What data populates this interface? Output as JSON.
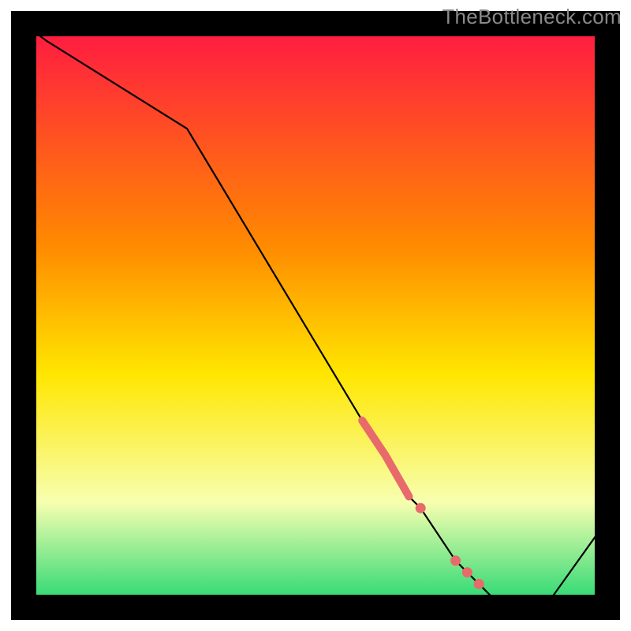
{
  "watermark": "TheBottleneck.com",
  "chart_data": {
    "type": "line",
    "title": "",
    "xlabel": "",
    "ylabel": "",
    "xlim": [
      0,
      100
    ],
    "ylim": [
      0,
      100
    ],
    "x": [
      0,
      4,
      28,
      58,
      62,
      66,
      68,
      72,
      74,
      76,
      78,
      80,
      85,
      90,
      100
    ],
    "values": [
      100,
      97,
      82,
      32,
      26,
      19,
      17,
      11,
      8,
      6,
      4,
      2,
      1,
      1,
      15
    ],
    "highlight_segment": {
      "x_start": 58,
      "x_end": 66,
      "width": 10
    },
    "markers_x": [
      68,
      74,
      76,
      78
    ],
    "colors": {
      "line": "#000000",
      "marker": "#e86a6a",
      "gradient_top": "#ff1744",
      "gradient_mid_top": "#ff8a00",
      "gradient_mid": "#ffe600",
      "gradient_mid_bottom": "#f7ffb0",
      "gradient_bottom": "#1fd66f",
      "frame": "#000000"
    }
  }
}
